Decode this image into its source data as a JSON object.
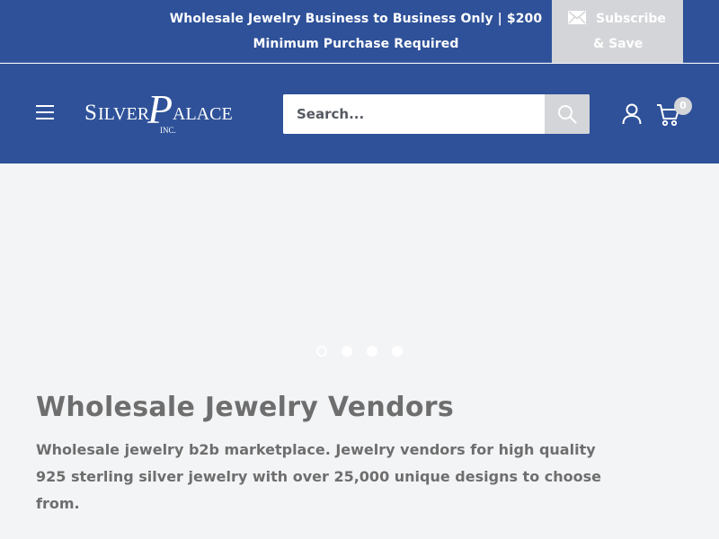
{
  "announcement": {
    "text": "Wholesale Jewelry Business to Business Only | $200 Minimum Purchase Required",
    "subscribe_line1": "Subscribe",
    "subscribe_line2": "& Save"
  },
  "header": {
    "logo_text_main": "SILVER PALACE",
    "logo_text_sub": "INC.",
    "search_placeholder": "Search...",
    "cart_count": "0"
  },
  "slideshow": {
    "slide_count": 4,
    "active_index": 0
  },
  "intro": {
    "title": "Wholesale Jewelry Vendors",
    "text": "Wholesale jewelry b2b marketplace. Jewelry vendors for high quality 925 sterling silver jewelry with over 25,000 unique designs to choose from."
  },
  "colors": {
    "brand_blue": "#2e5199",
    "muted_gray": "#d4d5d8",
    "page_bg": "#f3f4f6",
    "text_gray": "#6e6e6e"
  },
  "icons": [
    "mail-icon",
    "menu-icon",
    "search-icon",
    "account-icon",
    "cart-icon"
  ]
}
